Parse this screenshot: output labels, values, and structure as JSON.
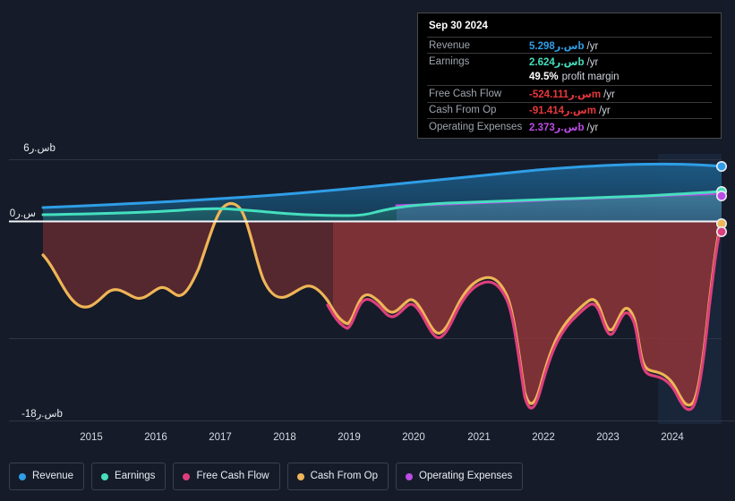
{
  "tooltip": {
    "date": "Sep 30 2024",
    "rows": [
      {
        "key": "Revenue",
        "num": "5.298س.رb",
        "unit": "/yr",
        "color": "rev"
      },
      {
        "key": "Earnings",
        "num": "2.624س.رb",
        "unit": "/yr",
        "color": "earn"
      },
      {
        "key": "",
        "margin_pct": "49.5%",
        "margin_text": "profit margin",
        "color": "white"
      },
      {
        "key": "Free Cash Flow",
        "num": "-524.111س.رm",
        "unit": "/yr",
        "color": "neg"
      },
      {
        "key": "Cash From Op",
        "num": "-91.414س.رm",
        "unit": "/yr",
        "color": "neg"
      },
      {
        "key": "Operating Expenses",
        "num": "2.373س.رb",
        "unit": "/yr",
        "color": "opex"
      }
    ]
  },
  "legend": [
    {
      "label": "Revenue",
      "color": "#2f9ee6"
    },
    {
      "label": "Earnings",
      "color": "#45dfbe"
    },
    {
      "label": "Free Cash Flow",
      "color": "#dd3f7c"
    },
    {
      "label": "Cash From Op",
      "color": "#efb556"
    },
    {
      "label": "Operating Expenses",
      "color": "#bb4de6"
    }
  ],
  "chart_data": {
    "type": "area",
    "title": "",
    "xlabel": "",
    "ylabel": "",
    "currency_symbol": "س.ر",
    "ylim": [
      -18,
      6
    ],
    "y_ticks": [
      {
        "value": 6,
        "label": "6س.رb"
      },
      {
        "value": 0,
        "label": "0س.ر"
      },
      {
        "value": -18,
        "label": "-18س.رb"
      }
    ],
    "grid": true,
    "legend_position": "bottom",
    "x_ticks": [
      "2015",
      "2016",
      "2017",
      "2018",
      "2019",
      "2020",
      "2021",
      "2022",
      "2023",
      "2024"
    ],
    "x_range": [
      "2014-03",
      "2024-12"
    ],
    "series": [
      {
        "name": "Revenue",
        "color": "#2f9ee6",
        "unit": "b",
        "x": [
          2014.2,
          2015.0,
          2016.0,
          2017.0,
          2018.0,
          2019.0,
          2020.0,
          2021.0,
          2022.0,
          2023.0,
          2024.0,
          2024.75
        ],
        "values": [
          2.55,
          2.7,
          2.9,
          3.05,
          3.18,
          3.42,
          3.7,
          3.95,
          4.28,
          4.62,
          5.05,
          5.298
        ]
      },
      {
        "name": "Earnings",
        "color": "#45dfbe",
        "unit": "b",
        "x": [
          2014.2,
          2015.0,
          2016.0,
          2017.0,
          2018.0,
          2019.0,
          2020.0,
          2021.0,
          2022.0,
          2023.0,
          2024.0,
          2024.75
        ],
        "values": [
          1.0,
          0.98,
          1.02,
          1.08,
          1.0,
          0.82,
          0.78,
          1.3,
          1.65,
          1.95,
          2.35,
          2.624
        ]
      },
      {
        "name": "Operating Expenses",
        "color": "#bb4de6",
        "unit": "b",
        "x": [
          2019.6,
          2020.0,
          2021.0,
          2022.0,
          2023.0,
          2024.0,
          2024.75
        ],
        "values": [
          1.52,
          1.55,
          1.68,
          1.85,
          2.02,
          2.24,
          2.373
        ]
      },
      {
        "name": "Cash From Op",
        "color": "#efb556",
        "unit": "b",
        "x": [
          2014.2,
          2014.5,
          2014.9,
          2015.2,
          2015.5,
          2015.9,
          2016.3,
          2016.6,
          2016.85,
          2017.0,
          2017.2,
          2017.5,
          2017.9,
          2018.2,
          2018.5,
          2018.75,
          2019.0,
          2019.25,
          2019.5,
          2019.75,
          2020.0,
          2020.3,
          2020.6,
          2020.9,
          2021.15,
          2021.4,
          2021.6,
          2021.8,
          2022.0,
          2022.3,
          2022.6,
          2022.8,
          2023.0,
          2023.2,
          2023.35,
          2023.5,
          2023.8,
          2024.0,
          2024.25,
          2024.5,
          2024.75
        ],
        "values": [
          -3.2,
          -4.6,
          -6.6,
          -5.8,
          -6.2,
          -5.9,
          -4.0,
          -5.6,
          -2.0,
          1.3,
          1.2,
          -3.0,
          -5.5,
          -4.8,
          -5.3,
          -8.5,
          -6.0,
          -7.0,
          -5.5,
          -8.3,
          -6.3,
          -2.0,
          -1.8,
          -6.5,
          -15.0,
          -12.0,
          -9.0,
          -6.0,
          -4.2,
          -5.5,
          -4.0,
          -9.0,
          -10.5,
          -11.0,
          -11.8,
          -13.0,
          -16.8,
          -14.0,
          -7.0,
          -2.5,
          -0.091
        ]
      },
      {
        "name": "Free Cash Flow",
        "color": "#dd3f7c",
        "unit": "b",
        "x": [
          2018.75,
          2019.0,
          2019.25,
          2019.5,
          2019.75,
          2020.0,
          2020.3,
          2020.6,
          2020.9,
          2021.15,
          2021.4,
          2021.6,
          2021.8,
          2022.0,
          2022.3,
          2022.6,
          2022.8,
          2023.0,
          2023.2,
          2023.35,
          2023.5,
          2023.8,
          2024.0,
          2024.25,
          2024.5,
          2024.75
        ],
        "values": [
          -8.7,
          -6.3,
          -7.3,
          -5.8,
          -8.6,
          -6.6,
          -2.3,
          -2.1,
          -6.8,
          -15.3,
          -12.3,
          -9.3,
          -6.3,
          -4.5,
          -5.8,
          -4.3,
          -9.3,
          -10.8,
          -11.3,
          -12.1,
          -13.3,
          -17.1,
          -14.3,
          -7.3,
          -2.8,
          -0.524
        ]
      }
    ]
  }
}
